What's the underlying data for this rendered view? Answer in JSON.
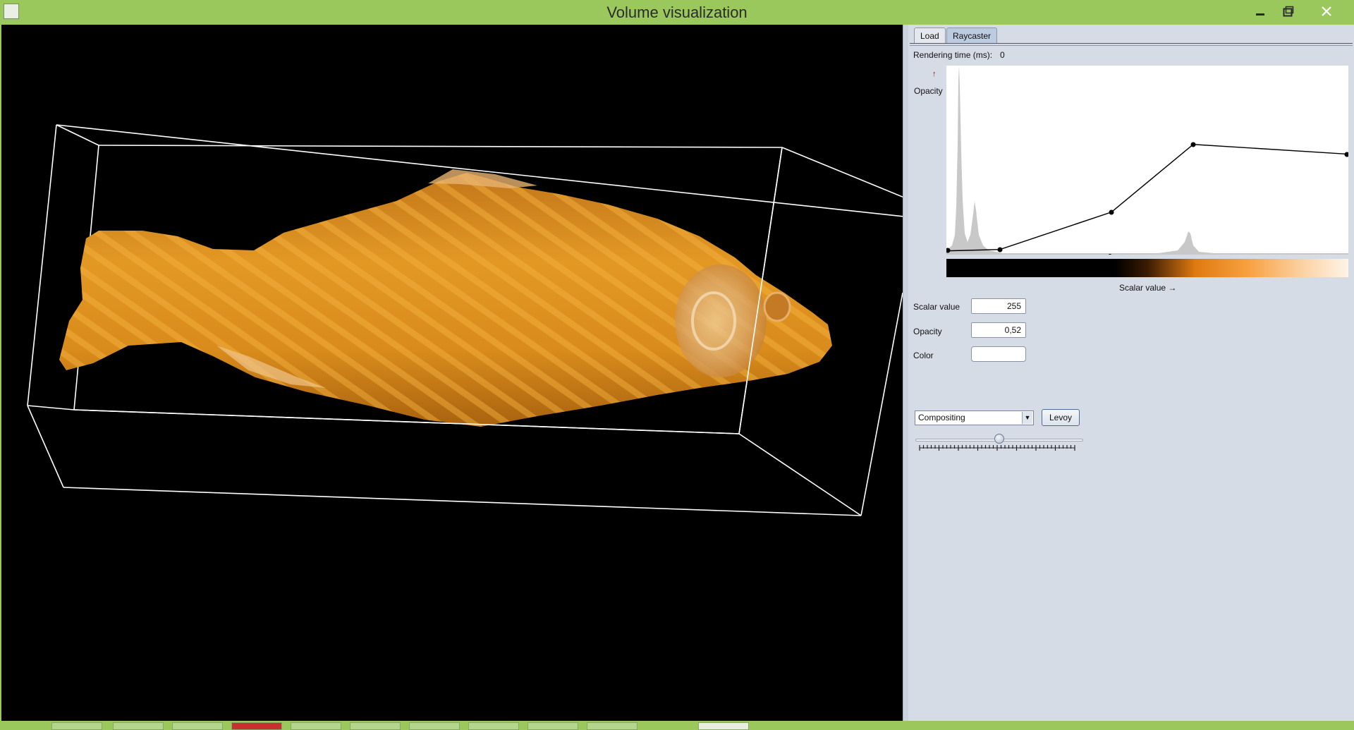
{
  "window": {
    "title": "Volume visualization"
  },
  "controls": {
    "minimize_icon": "minimize-icon",
    "maximize_icon": "maximize-icon",
    "close_icon": "close-icon"
  },
  "tabs": [
    {
      "label": "Load"
    },
    {
      "label": "Raycaster",
      "selected": true
    }
  ],
  "panel": {
    "rendering_time_label": "Rendering time (ms):",
    "rendering_time_value": "0",
    "opacity_axis_label": "Opacity",
    "opacity_axis_arrow": "↑",
    "scalar_axis_label": "Scalar value →",
    "scalar_value_label": "Scalar value",
    "scalar_value": "255",
    "opacity_label": "Opacity",
    "opacity_value": "0,52",
    "color_label": "Color",
    "mode_selected": "Compositing",
    "levoy_button": "Levoy",
    "slider_position": 0.5
  },
  "colors": {
    "titlebar": "#9bc85c",
    "panel": "#d6dce6",
    "viewport": "#000000",
    "fish": "#e0901c"
  }
}
